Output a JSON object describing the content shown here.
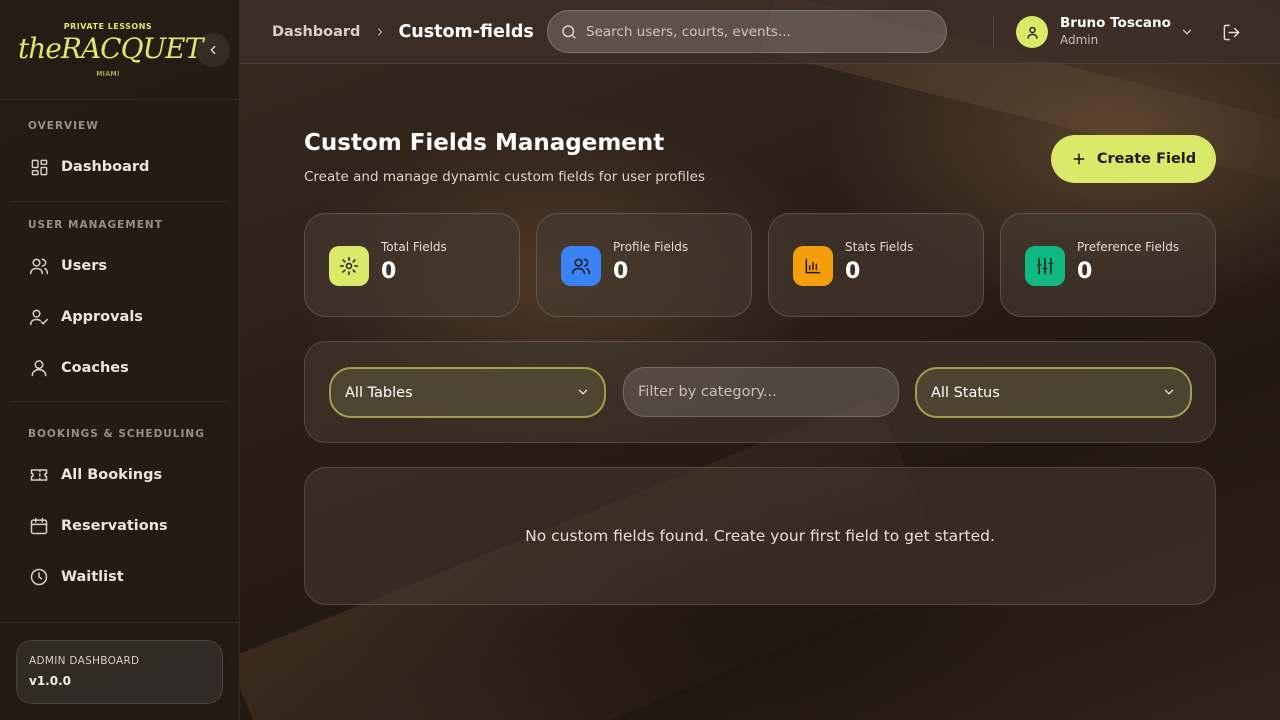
{
  "brand": {
    "top": "PRIVATE LESSONS",
    "name": "theRACQUET",
    "bottom": "MIAMI",
    "accent": "#dbe96b"
  },
  "sidebar": {
    "sections": [
      {
        "heading": "OVERVIEW",
        "items": [
          {
            "label": "Dashboard",
            "icon": "dashboard-grid-icon"
          }
        ]
      },
      {
        "heading": "USER MANAGEMENT",
        "items": [
          {
            "label": "Users",
            "icon": "users-icon"
          },
          {
            "label": "Approvals",
            "icon": "user-check-icon"
          },
          {
            "label": "Coaches",
            "icon": "user-icon"
          }
        ]
      },
      {
        "heading": "BOOKINGS & SCHEDULING",
        "items": [
          {
            "label": "All Bookings",
            "icon": "ticket-icon"
          },
          {
            "label": "Reservations",
            "icon": "calendar-icon"
          },
          {
            "label": "Waitlist",
            "icon": "clock-icon"
          }
        ]
      }
    ],
    "version_box": {
      "title": "ADMIN DASHBOARD",
      "version": "v1.0.0"
    }
  },
  "header": {
    "breadcrumb": {
      "parent": "Dashboard",
      "current": "Custom-fields"
    },
    "search_placeholder": "Search users, courts, events...",
    "user": {
      "name": "Bruno Toscano",
      "role": "Admin"
    }
  },
  "main": {
    "title": "Custom Fields Management",
    "subtitle": "Create and manage dynamic custom fields for user profiles",
    "create_button": "Create Field",
    "stats": [
      {
        "label": "Total Fields",
        "value": "0",
        "icon": "gear-icon",
        "color": "#dbe96b"
      },
      {
        "label": "Profile Fields",
        "value": "0",
        "icon": "users-icon",
        "color": "#3b82f6"
      },
      {
        "label": "Stats Fields",
        "value": "0",
        "icon": "bar-chart-icon",
        "color": "#f59e0b"
      },
      {
        "label": "Preference Fields",
        "value": "0",
        "icon": "sliders-icon",
        "color": "#10b981"
      }
    ],
    "filters": {
      "table_select": "All Tables",
      "category_placeholder": "Filter by category...",
      "status_select": "All Status"
    },
    "empty_message": "No custom fields found. Create your first field to get started."
  }
}
